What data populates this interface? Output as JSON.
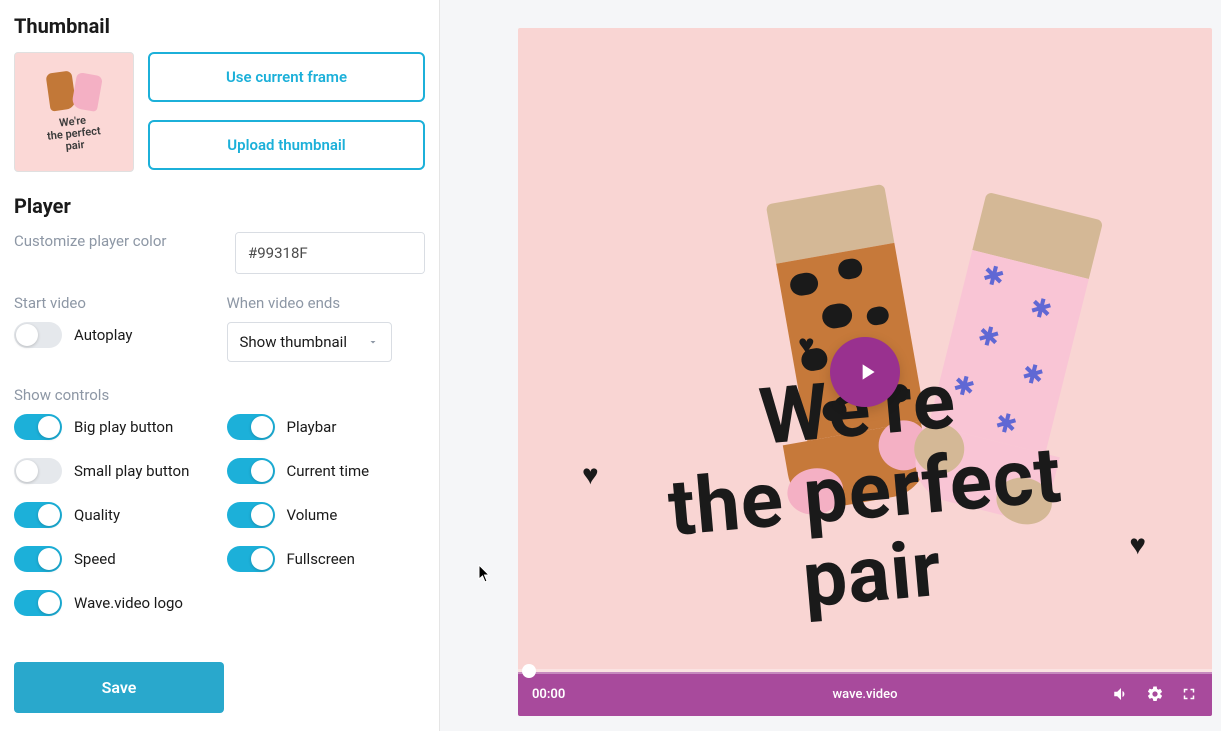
{
  "sections": {
    "thumbnail_title": "Thumbnail",
    "player_title": "Player"
  },
  "thumbnail": {
    "preview_text_l1": "We're",
    "preview_text_l2": "the perfect",
    "preview_text_l3": "pair",
    "use_current_frame": "Use current frame",
    "upload_thumbnail": "Upload thumbnail"
  },
  "player": {
    "color_label": "Customize player color",
    "color_value": "#99318F",
    "start_video_label": "Start video",
    "autoplay_label": "Autoplay",
    "when_ends_label": "When video ends",
    "when_ends_value": "Show thumbnail",
    "show_controls_label": "Show controls",
    "controls": {
      "big_play_button": "Big play button",
      "small_play_button": "Small play button",
      "quality": "Quality",
      "speed": "Speed",
      "wave_logo": "Wave.video logo",
      "playbar": "Playbar",
      "current_time": "Current time",
      "volume": "Volume",
      "fullscreen": "Fullscreen"
    },
    "save": "Save"
  },
  "preview": {
    "text_l1": "We're",
    "text_l2": "the perfect",
    "text_l3": "pair",
    "time": "00:00",
    "brand": "wave.video"
  }
}
